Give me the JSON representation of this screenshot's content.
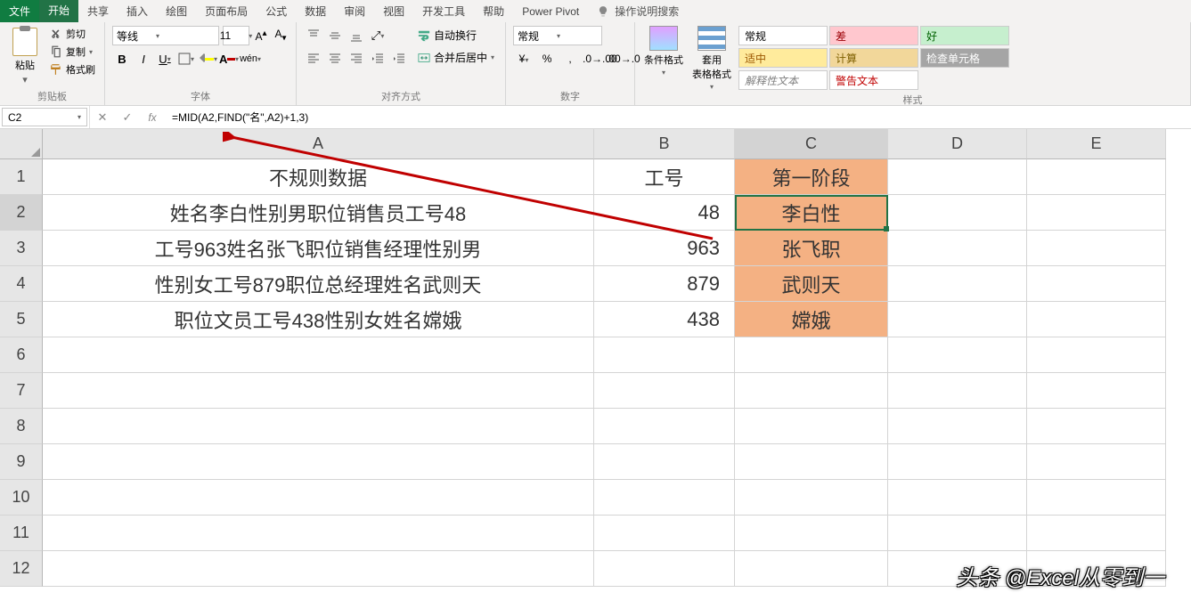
{
  "menu": {
    "tabs": [
      "文件",
      "开始",
      "共享",
      "插入",
      "绘图",
      "页面布局",
      "公式",
      "数据",
      "审阅",
      "视图",
      "开发工具",
      "帮助",
      "Power Pivot"
    ],
    "tellme": "操作说明搜索",
    "active_index": 1
  },
  "ribbon": {
    "clipboard": {
      "paste": "粘贴",
      "cut": "剪切",
      "copy": "复制",
      "format_painter": "格式刷",
      "label": "剪贴板"
    },
    "font": {
      "name": "等线",
      "size": "11",
      "label": "字体"
    },
    "alignment": {
      "wrap": "自动换行",
      "merge": "合并后居中",
      "label": "对齐方式"
    },
    "number": {
      "format": "常规",
      "label": "数字"
    },
    "styles": {
      "cond": "条件格式",
      "table": "套用\n表格格式",
      "cells": [
        "常规",
        "差",
        "好",
        "适中",
        "计算",
        "检查单元格",
        "解释性文本",
        "警告文本"
      ],
      "label": "样式"
    }
  },
  "formula_bar": {
    "cell_ref": "C2",
    "formula": "=MID(A2,FIND(\"名\",A2)+1,3)"
  },
  "grid": {
    "cols": [
      "A",
      "B",
      "C",
      "D",
      "E"
    ],
    "rows": [
      "1",
      "2",
      "3",
      "4",
      "5",
      "6",
      "7",
      "8",
      "9",
      "10",
      "11",
      "12"
    ],
    "active_row": 2,
    "active_col": "C",
    "data": [
      {
        "A": "不规则数据",
        "B": "工号",
        "C": "第一阶段"
      },
      {
        "A": "姓名李白性别男职位销售员工号48",
        "B": "48",
        "C": "李白性"
      },
      {
        "A": "工号963姓名张飞职位销售经理性别男",
        "B": "963",
        "C": "张飞职"
      },
      {
        "A": "性别女工号879职位总经理姓名武则天",
        "B": "879",
        "C": "武则天"
      },
      {
        "A": "职位文员工号438性别女姓名嫦娥",
        "B": "438",
        "C": "嫦娥"
      }
    ]
  },
  "watermark": "头条 @Excel从零到一"
}
